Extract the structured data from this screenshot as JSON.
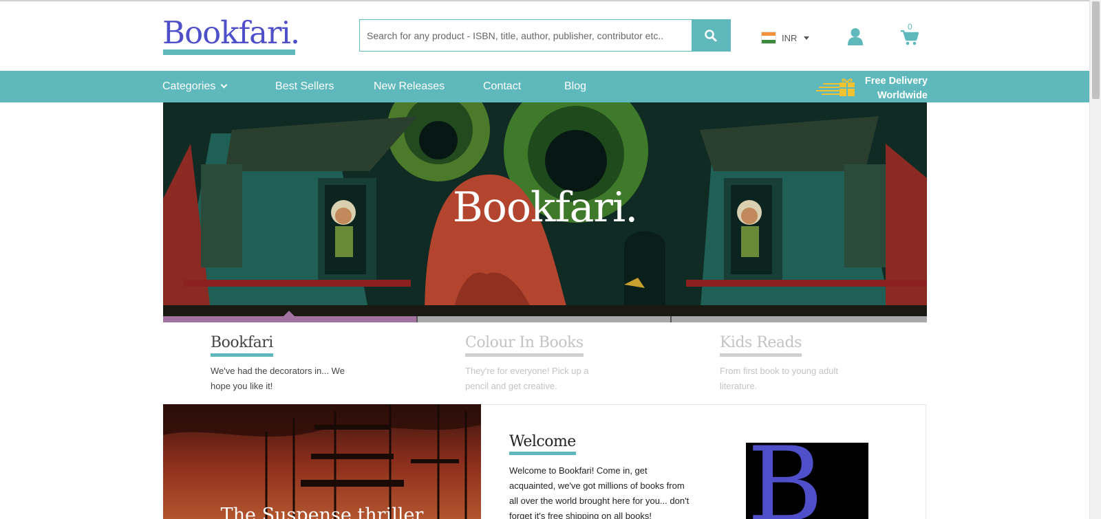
{
  "brand": {
    "logo_text": "Bookfari."
  },
  "search": {
    "placeholder": "Search for any product - ISBN, title, author, publisher, contributor etc.."
  },
  "currency": {
    "code": "INR"
  },
  "cart": {
    "count": "0"
  },
  "nav": {
    "items": [
      {
        "label": "Categories"
      },
      {
        "label": "Best Sellers"
      },
      {
        "label": "New Releases"
      },
      {
        "label": "Contact"
      },
      {
        "label": "Blog"
      }
    ],
    "free_delivery_line1": "Free Delivery",
    "free_delivery_line2": "Worldwide"
  },
  "hero": {
    "title": "Bookfari."
  },
  "slides": [
    {
      "title": "Bookfari",
      "description": "We've had the decorators in... We hope you like it!"
    },
    {
      "title": "Colour In Books",
      "description": "They're for everyone! Pick up a pencil and get creative."
    },
    {
      "title": "Kids Reads",
      "description": "From first book to young adult literature."
    }
  ],
  "promo": {
    "title": "The Suspense thriller"
  },
  "welcome": {
    "title": "Welcome",
    "text": "Welcome to Bookfari! Come in, get acquainted, we've got millions of books from all over the world brought here for you... don't forget it's free shipping on all books!",
    "logo_letter": "B"
  },
  "colors": {
    "accent": "#5fb8bb",
    "brand": "#4f4fc9",
    "slide_active": "#a073a0"
  }
}
